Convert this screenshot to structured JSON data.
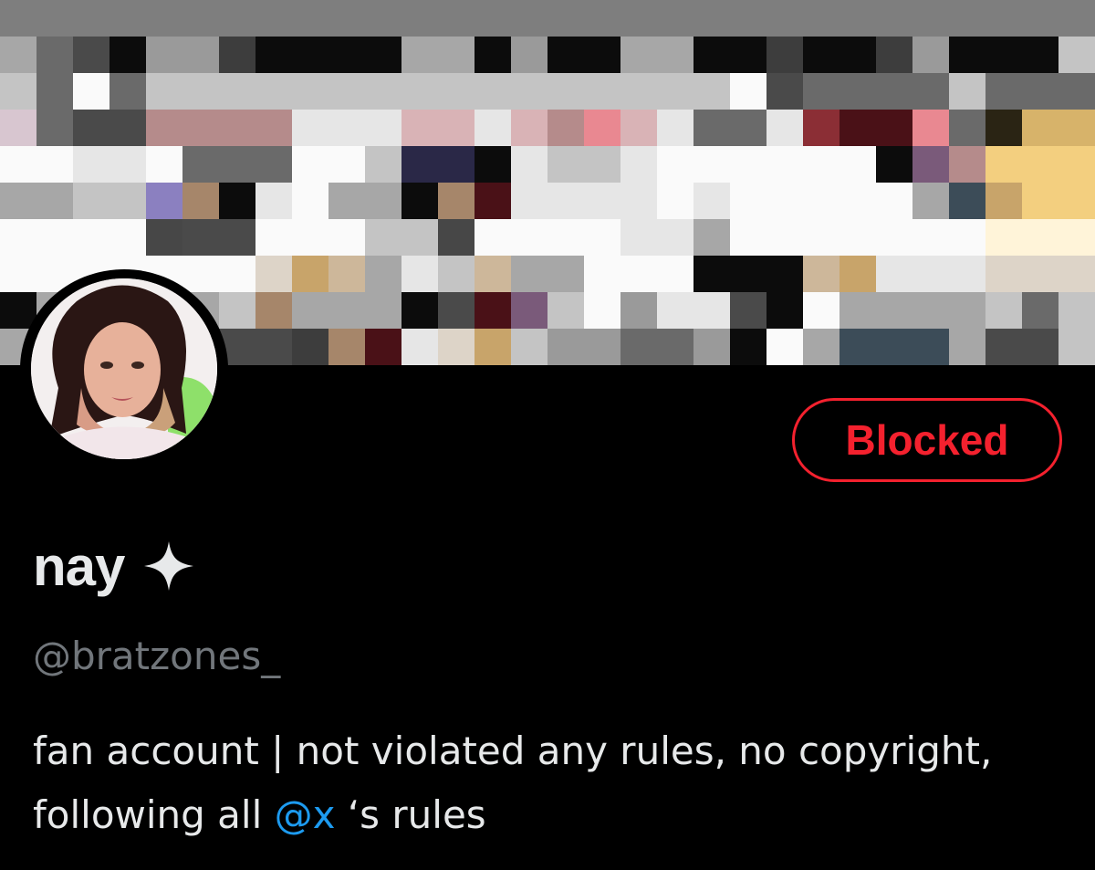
{
  "profile": {
    "display_name": "nay",
    "verified_icon": "sparkle-icon",
    "handle": "@bratzones_",
    "relationship_button": "Blocked",
    "bio": {
      "text_before": "fan account | not violated any rules, no copyright, following all",
      "mention": "@x",
      "text_after": "‘s rules"
    }
  },
  "colors": {
    "background": "#000000",
    "primary_text": "#e7e9ea",
    "secondary_text": "#71767b",
    "blocked_red": "#f4212e",
    "mention_blue": "#1d9bf0"
  },
  "banner": {
    "pixelated": true,
    "cols": 30,
    "rows": 9,
    "palette": [
      "#a7a7a7",
      "#6a6a6a",
      "#4a4a4a",
      "#0c0c0c",
      "#9a9a9a",
      "#3d3d3d",
      "#c4c4c4",
      "#fafafa",
      "#d8c6d0",
      "#b58b8b",
      "#e6e6e6",
      "#d9b3b6",
      "#e98891",
      "#8b2e35",
      "#4a1117",
      "#2a2414",
      "#d7b36a",
      "#f3cf7f",
      "#f4f4f6",
      "#2a2847",
      "#7a5a7a",
      "#8b80c0",
      "#a6866a",
      "#474747",
      "#fff4d9",
      "#c8a46a",
      "#cdb79a",
      "#3c4c58",
      "#8a7ab0",
      "#ddd4c8"
    ],
    "cells": [
      "0,1,2,3,4,4,5,3,3,3,3,0,0,3,4,3,3,0,0,3,3,5,3,3,5,4,3,3,3,6",
      "6,1,7,1,6,6,6,6,6,6,6,6,6,6,6,6,6,6,6,6,7,2,1,1,1,1,6,1,1,1",
      "8,1,2,2,9,9,9,9,10,10,10,11,11,10,11,9,12,11,10,1,1,10,13,14,14,12,1,15,16,16",
      "7,7,10,10,7,1,1,1,7,7,6,19,19,3,10,6,6,10,7,7,7,7,7,7,3,20,9,17,17,17",
      "0,0,6,6,21,22,3,10,7,0,0,3,22,14,10,10,10,10,7,10,7,7,7,7,7,0,27,25,17,17",
      "7,7,7,7,23,2,2,7,7,7,6,6,23,7,7,7,7,10,10,0,7,7,7,7,7,7,7,24,24,24",
      "7,7,7,7,7,7,7,29,25,26,0,10,6,26,0,0,7,7,7,3,3,3,26,25,10,10,10,29,29,29",
      "3,0,0,6,0,0,6,22,0,0,0,3,2,14,20,6,7,4,10,10,2,3,7,0,0,0,0,6,1,6",
      "0,0,0,6,0,2,2,2,5,22,14,10,29,25,6,4,4,1,1,4,3,7,0,27,27,27,0,2,2,6"
    ]
  }
}
